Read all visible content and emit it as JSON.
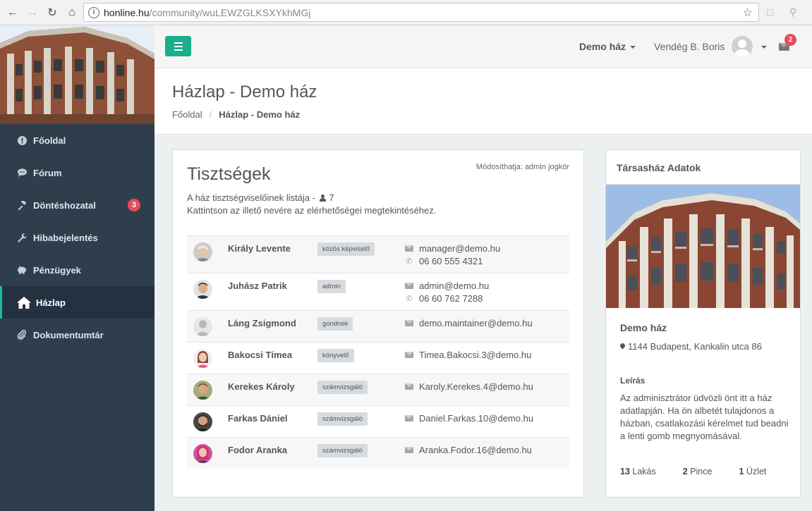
{
  "browser": {
    "host": "honline.hu",
    "path": "/community/wuLEWZGLKSXYkhMGj"
  },
  "sidebar": {
    "items": [
      {
        "label": "Főoldal",
        "icon": "exclamation-circle-icon"
      },
      {
        "label": "Fórum",
        "icon": "chat-bubble-icon"
      },
      {
        "label": "Döntéshozatal",
        "icon": "gavel-icon",
        "badge": "3"
      },
      {
        "label": "Hibabejelentés",
        "icon": "wrench-icon"
      },
      {
        "label": "Pénzügyek",
        "icon": "piggy-bank-icon"
      },
      {
        "label": "Házlap",
        "icon": "home-icon",
        "active": true
      },
      {
        "label": "Dokumentumtár",
        "icon": "paperclip-icon"
      }
    ]
  },
  "topbar": {
    "house_select": "Demo ház",
    "user_name": "Vendég B. Boris",
    "mail_badge": "2"
  },
  "header": {
    "title": "Házlap - Demo ház",
    "breadcrumb": [
      "Főoldal",
      "Házlap - Demo ház"
    ]
  },
  "officers_card": {
    "title": "Tisztségek",
    "modify_note": "Módosíthatja: admin jogkör",
    "description_prefix": "A ház tisztségviselőinek listája -",
    "count": "7",
    "description_line2": "Kattintson az illető nevére az elérhetőségei megtekintéséhez.",
    "rows": [
      {
        "name": "Király Levente",
        "role": "közös képviselő",
        "email": "manager@demo.hu",
        "phone": "06 60 555 4321"
      },
      {
        "name": "Juhász Patrik",
        "role": "admin",
        "email": "admin@demo.hu",
        "phone": "06 60 762 7288"
      },
      {
        "name": "Láng Zsigmond",
        "role": "gondnok",
        "email": "demo.maintainer@demo.hu",
        "phone": ""
      },
      {
        "name": "Bakocsi Tímea",
        "role": "könyvelő",
        "email": "Timea.Bakocsi.3@demo.hu",
        "phone": ""
      },
      {
        "name": "Kerekes Károly",
        "role": "számvizsgáló",
        "email": "Karoly.Kerekes.4@demo.hu",
        "phone": ""
      },
      {
        "name": "Farkas Dániel",
        "role": "számvizsgáló",
        "email": "Daniel.Farkas.10@demo.hu",
        "phone": ""
      },
      {
        "name": "Fodor Aranka",
        "role": "számvizsgáló",
        "email": "Aranka.Fodor.16@demo.hu",
        "phone": ""
      }
    ]
  },
  "side_card": {
    "title": "Társasház Adatok",
    "house_name": "Demo ház",
    "address": "1144 Budapest, Kankalin utca 86",
    "description_label": "Leírás",
    "description": "Az adminisztrátor üdvözli önt itt a ház adatlapján. Ha ön albetét tulajdonos a házban, csatlakozási kérelmet tud beadni a lenti gomb megnyomásával.",
    "stats": [
      {
        "value": "13",
        "label": "Lakás"
      },
      {
        "value": "2",
        "label": "Pince"
      },
      {
        "value": "1",
        "label": "Üzlet"
      }
    ]
  },
  "colors": {
    "accent": "#1aae8a",
    "sidebar_bg": "#2f3e4c",
    "badge": "#e74c5e"
  }
}
